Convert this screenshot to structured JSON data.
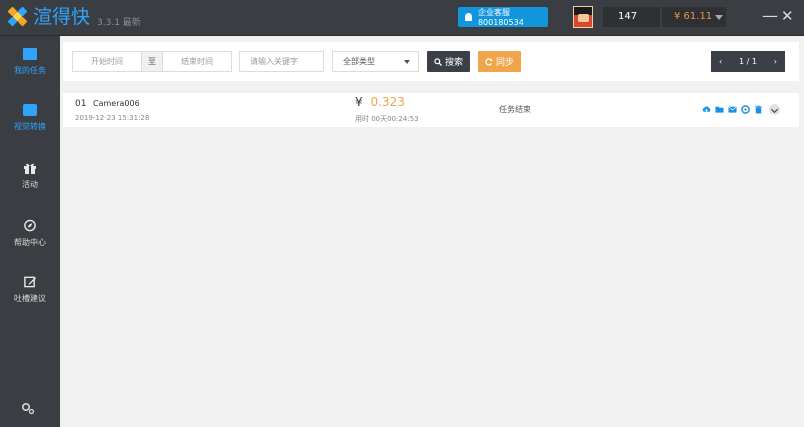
{
  "app": {
    "name": "渲得快",
    "version": "3.3.1 最新"
  },
  "header": {
    "service_label": "企业客服 800180534",
    "user_id": "147",
    "balance": "¥ 61.11",
    "minimize": "—",
    "close": "✕"
  },
  "sidebar": {
    "items": [
      {
        "label": "我的任务",
        "icon": "task-list-icon",
        "active": true
      },
      {
        "label": "视觉转换",
        "icon": "briefcase-icon",
        "active": false
      },
      {
        "label": "活动",
        "icon": "gift-icon",
        "active": false
      },
      {
        "label": "帮助中心",
        "icon": "compass-icon",
        "active": false
      },
      {
        "label": "吐槽建议",
        "icon": "edit-icon",
        "active": false
      }
    ],
    "settings_icon": "settings-icon"
  },
  "toolbar": {
    "start_placeholder": "开始时间",
    "separator": "至",
    "end_placeholder": "结束时间",
    "keyword_placeholder": "请输入关键字",
    "type_selected": "全部类型",
    "search_label": "搜索",
    "sync_label": "同步",
    "page_prev": "‹",
    "page_info": "1 / 1",
    "page_next": "›"
  },
  "tasks": [
    {
      "index": "01",
      "name": "Camera006",
      "date": "2019-12-23 15:31:28",
      "currency": "¥",
      "price": "0.323",
      "duration": "用时 00天00:24:53",
      "status": "任务结束"
    }
  ],
  "colors": {
    "accent": "#2ea4ff",
    "price": "#f0a54d",
    "dark": "#3a3d42",
    "action": "#1890e6"
  }
}
